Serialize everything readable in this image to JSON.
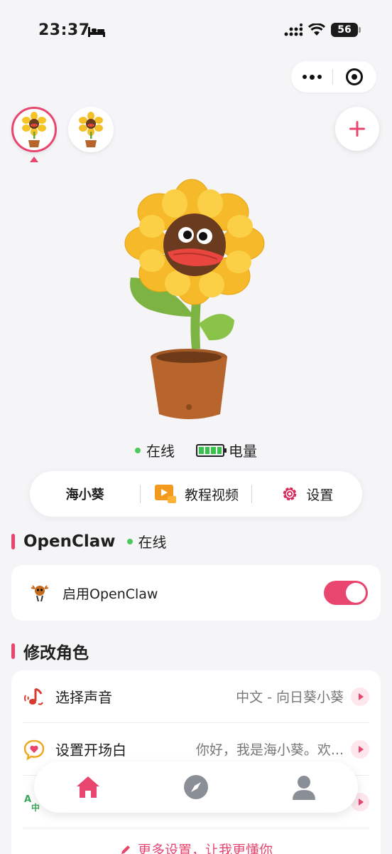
{
  "status_bar": {
    "time": "23:37",
    "battery": "56"
  },
  "device_status": {
    "online": "在线",
    "battery_label": "电量"
  },
  "action_pill": {
    "name": "海小葵",
    "tutorial": "教程视频",
    "settings": "设置"
  },
  "openclaw": {
    "title": "OpenClaw",
    "status": "在线",
    "enable_label": "启用OpenClaw",
    "enabled": true
  },
  "role": {
    "title": "修改角色",
    "rows": [
      {
        "title": "选择声音",
        "value": "中文 - 向日葵小葵"
      },
      {
        "title": "设置开场白",
        "value": "你好，我是海小葵。欢..."
      },
      {
        "title": "",
        "value": ""
      }
    ],
    "more": "更多设置，让我更懂你"
  },
  "colors": {
    "accent": "#e8466f",
    "online": "#4cc95c",
    "background": "#f5f5f7"
  }
}
